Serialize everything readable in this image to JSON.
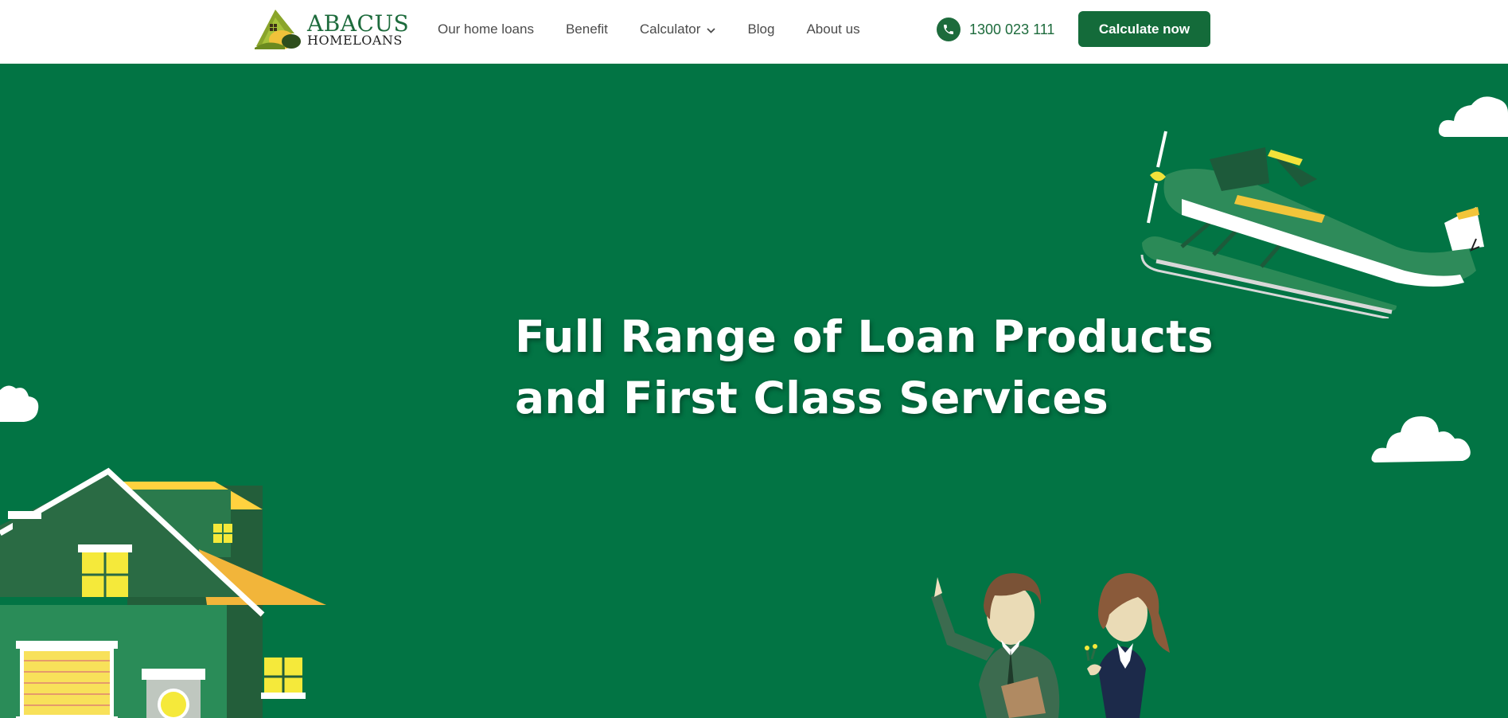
{
  "brand": {
    "name_top": "ABACUS",
    "name_bottom": "HOMELOANS",
    "logo_icon": "house-logo-icon"
  },
  "nav": {
    "items": [
      {
        "label": "Our home loans"
      },
      {
        "label": "Benefit"
      },
      {
        "label": "Calculator",
        "has_dropdown": true,
        "dropdown_icon": "chevron-down-icon"
      },
      {
        "label": "Blog"
      },
      {
        "label": "About us"
      }
    ]
  },
  "contact": {
    "phone_icon": "phone-icon",
    "phone": "1300 023 111"
  },
  "cta": {
    "label": "Calculate now"
  },
  "hero": {
    "headline_line1": "Full Range of Loan Products",
    "headline_line2": "and First Class Services",
    "illustrations": [
      "cloud",
      "seaplane",
      "house",
      "two-people"
    ]
  },
  "colors": {
    "brand_green": "#1d6b3c",
    "hero_green": "#027444",
    "button_green": "#146b3a",
    "accent_yellow": "#f8c53d"
  }
}
